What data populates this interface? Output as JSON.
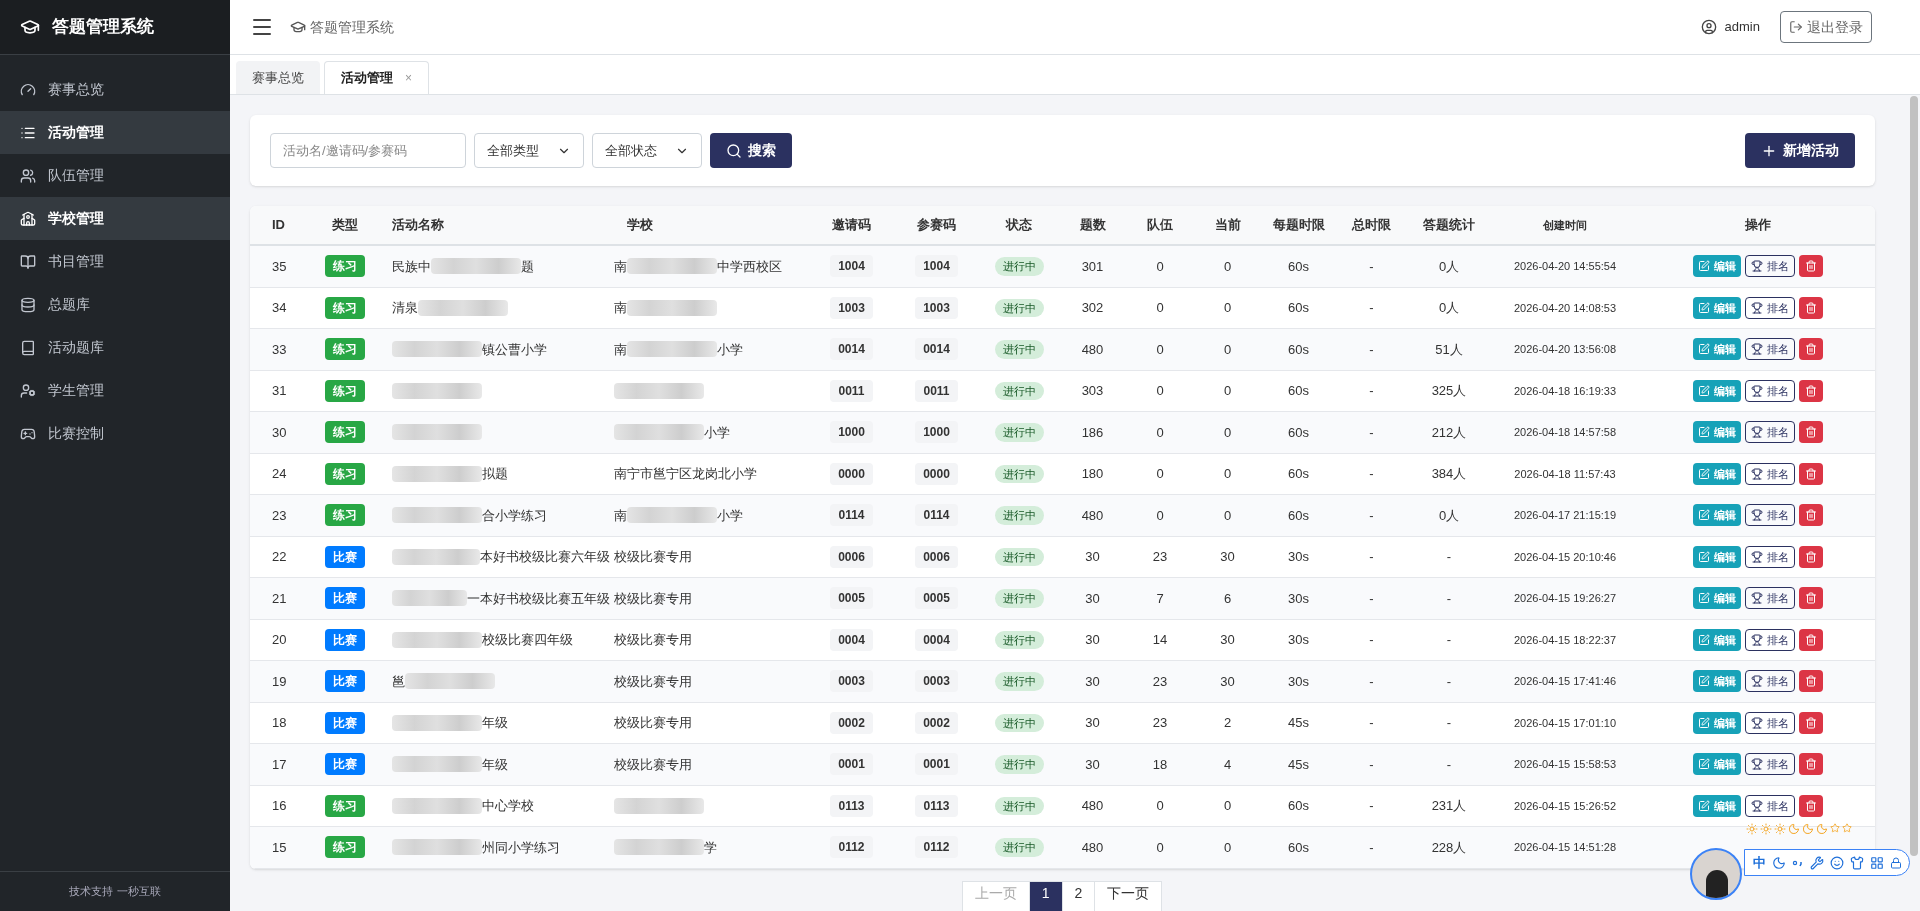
{
  "brand": "答题管理系统",
  "sidebar": {
    "items": [
      {
        "label": "赛事总览",
        "selected": false
      },
      {
        "label": "活动管理",
        "selected": true
      },
      {
        "label": "队伍管理",
        "selected": false
      },
      {
        "label": "学校管理",
        "selected": true
      },
      {
        "label": "书目管理",
        "selected": false
      },
      {
        "label": "总题库",
        "selected": false
      },
      {
        "label": "活动题库",
        "selected": false
      },
      {
        "label": "学生管理",
        "selected": false
      },
      {
        "label": "比赛控制",
        "selected": false
      }
    ],
    "footer": "技术支持 一秒互联"
  },
  "header": {
    "breadcrumb": "答题管理系统",
    "user": "admin",
    "logout": "退出登录"
  },
  "tabs": [
    {
      "label": "赛事总览",
      "selected": false,
      "closable": false
    },
    {
      "label": "活动管理",
      "selected": true,
      "closable": true,
      "close": "×"
    }
  ],
  "filters": {
    "search": {
      "placeholder": "活动名/邀请码/参赛码"
    },
    "type_select": "全部类型",
    "status_select": "全部状态",
    "search_button": "搜索",
    "add_button": "新增活动"
  },
  "table": {
    "columns": [
      "ID",
      "类型",
      "活动名称",
      "学校",
      "邀请码",
      "参赛码",
      "状态",
      "题数",
      "队伍",
      "当前",
      "每题时限",
      "总时限",
      "答题统计",
      "创建时间",
      "操作"
    ],
    "rows": [
      {
        "id": "35",
        "type": {
          "kind": "practice",
          "label": "练习"
        },
        "name": [
          {
            "kind": "text",
            "text": "民族中"
          },
          {
            "kind": "blur"
          },
          {
            "kind": "text",
            "text": "题"
          }
        ],
        "school": [
          {
            "kind": "text",
            "text": "南"
          },
          {
            "kind": "blur"
          },
          {
            "kind": "text",
            "text": "中学西校区"
          }
        ],
        "invite": "1004",
        "code": "1004",
        "status": "进行中",
        "questions": "301",
        "teams": "0",
        "current": "0",
        "per_limit": "60s",
        "total_limit": "-",
        "stats": "0人",
        "created": "2026-04-20 14:55:54",
        "edit": "编辑",
        "rank": "排名",
        "actions_visible": true
      },
      {
        "id": "34",
        "type": {
          "kind": "practice",
          "label": "练习"
        },
        "name": [
          {
            "kind": "text",
            "text": "清泉"
          },
          {
            "kind": "blur"
          }
        ],
        "school": [
          {
            "kind": "text",
            "text": "南"
          },
          {
            "kind": "blur"
          }
        ],
        "invite": "1003",
        "code": "1003",
        "status": "进行中",
        "questions": "302",
        "teams": "0",
        "current": "0",
        "per_limit": "60s",
        "total_limit": "-",
        "stats": "0人",
        "created": "2026-04-20 14:08:53",
        "edit": "编辑",
        "rank": "排名",
        "actions_visible": true
      },
      {
        "id": "33",
        "type": {
          "kind": "practice",
          "label": "练习"
        },
        "name": [
          {
            "kind": "blur"
          },
          {
            "kind": "text",
            "text": "镇公曹小学"
          }
        ],
        "school": [
          {
            "kind": "text",
            "text": "南"
          },
          {
            "kind": "blur"
          },
          {
            "kind": "text",
            "text": "小学"
          }
        ],
        "invite": "0014",
        "code": "0014",
        "status": "进行中",
        "questions": "480",
        "teams": "0",
        "current": "0",
        "per_limit": "60s",
        "total_limit": "-",
        "stats": "51人",
        "created": "2026-04-20 13:56:08",
        "edit": "编辑",
        "rank": "排名",
        "actions_visible": true
      },
      {
        "id": "31",
        "type": {
          "kind": "practice",
          "label": "练习"
        },
        "name": [
          {
            "kind": "blur"
          }
        ],
        "school": [
          {
            "kind": "blur"
          }
        ],
        "invite": "0011",
        "code": "0011",
        "status": "进行中",
        "questions": "303",
        "teams": "0",
        "current": "0",
        "per_limit": "60s",
        "total_limit": "-",
        "stats": "325人",
        "created": "2026-04-18 16:19:33",
        "edit": "编辑",
        "rank": "排名",
        "actions_visible": true
      },
      {
        "id": "30",
        "type": {
          "kind": "practice",
          "label": "练习"
        },
        "name": [
          {
            "kind": "blur"
          }
        ],
        "school": [
          {
            "kind": "blur"
          },
          {
            "kind": "text",
            "text": "小学"
          }
        ],
        "invite": "1000",
        "code": "1000",
        "status": "进行中",
        "questions": "186",
        "teams": "0",
        "current": "0",
        "per_limit": "60s",
        "total_limit": "-",
        "stats": "212人",
        "created": "2026-04-18 14:57:58",
        "edit": "编辑",
        "rank": "排名",
        "actions_visible": true
      },
      {
        "id": "24",
        "type": {
          "kind": "practice",
          "label": "练习"
        },
        "name": [
          {
            "kind": "blur"
          },
          {
            "kind": "text",
            "text": "拟题"
          }
        ],
        "school": [
          {
            "kind": "text",
            "text": "南宁市邕宁区龙岗北小学"
          }
        ],
        "invite": "0000",
        "code": "0000",
        "status": "进行中",
        "questions": "180",
        "teams": "0",
        "current": "0",
        "per_limit": "60s",
        "total_limit": "-",
        "stats": "384人",
        "created": "2026-04-18 11:57:43",
        "edit": "编辑",
        "rank": "排名",
        "actions_visible": true
      },
      {
        "id": "23",
        "type": {
          "kind": "practice",
          "label": "练习"
        },
        "name": [
          {
            "kind": "blur"
          },
          {
            "kind": "text",
            "text": "合小学练习"
          }
        ],
        "school": [
          {
            "kind": "text",
            "text": "南"
          },
          {
            "kind": "blur"
          },
          {
            "kind": "text",
            "text": "小学"
          }
        ],
        "invite": "0114",
        "code": "0114",
        "status": "进行中",
        "questions": "480",
        "teams": "0",
        "current": "0",
        "per_limit": "60s",
        "total_limit": "-",
        "stats": "0人",
        "created": "2026-04-17 21:15:19",
        "edit": "编辑",
        "rank": "排名",
        "actions_visible": true
      },
      {
        "id": "22",
        "type": {
          "kind": "contest",
          "label": "比赛"
        },
        "name": [
          {
            "kind": "blur"
          },
          {
            "kind": "text",
            "text": "本好书校级比赛六年级"
          }
        ],
        "school": [
          {
            "kind": "text",
            "text": "校级比赛专用"
          }
        ],
        "invite": "0006",
        "code": "0006",
        "status": "进行中",
        "questions": "30",
        "teams": "23",
        "current": "30",
        "per_limit": "30s",
        "total_limit": "-",
        "stats": "-",
        "created": "2026-04-15 20:10:46",
        "edit": "编辑",
        "rank": "排名",
        "actions_visible": true
      },
      {
        "id": "21",
        "type": {
          "kind": "contest",
          "label": "比赛"
        },
        "name": [
          {
            "kind": "blur"
          },
          {
            "kind": "text",
            "text": "一本好书校级比赛五年级"
          }
        ],
        "school": [
          {
            "kind": "text",
            "text": "校级比赛专用"
          }
        ],
        "invite": "0005",
        "code": "0005",
        "status": "进行中",
        "questions": "30",
        "teams": "7",
        "current": "6",
        "per_limit": "30s",
        "total_limit": "-",
        "stats": "-",
        "created": "2026-04-15 19:26:27",
        "edit": "编辑",
        "rank": "排名",
        "actions_visible": true
      },
      {
        "id": "20",
        "type": {
          "kind": "contest",
          "label": "比赛"
        },
        "name": [
          {
            "kind": "blur"
          },
          {
            "kind": "text",
            "text": "校级比赛四年级"
          }
        ],
        "school": [
          {
            "kind": "text",
            "text": "校级比赛专用"
          }
        ],
        "invite": "0004",
        "code": "0004",
        "status": "进行中",
        "questions": "30",
        "teams": "14",
        "current": "30",
        "per_limit": "30s",
        "total_limit": "-",
        "stats": "-",
        "created": "2026-04-15 18:22:37",
        "edit": "编辑",
        "rank": "排名",
        "actions_visible": true
      },
      {
        "id": "19",
        "type": {
          "kind": "contest",
          "label": "比赛"
        },
        "name": [
          {
            "kind": "text",
            "text": "邕"
          },
          {
            "kind": "blur"
          }
        ],
        "school": [
          {
            "kind": "text",
            "text": "校级比赛专用"
          }
        ],
        "invite": "0003",
        "code": "0003",
        "status": "进行中",
        "questions": "30",
        "teams": "23",
        "current": "30",
        "per_limit": "30s",
        "total_limit": "-",
        "stats": "-",
        "created": "2026-04-15 17:41:46",
        "edit": "编辑",
        "rank": "排名",
        "actions_visible": true
      },
      {
        "id": "18",
        "type": {
          "kind": "contest",
          "label": "比赛"
        },
        "name": [
          {
            "kind": "blur"
          },
          {
            "kind": "text",
            "text": "年级"
          }
        ],
        "school": [
          {
            "kind": "text",
            "text": "校级比赛专用"
          }
        ],
        "invite": "0002",
        "code": "0002",
        "status": "进行中",
        "questions": "30",
        "teams": "23",
        "current": "2",
        "per_limit": "45s",
        "total_limit": "-",
        "stats": "-",
        "created": "2026-04-15 17:01:10",
        "edit": "编辑",
        "rank": "排名",
        "actions_visible": true
      },
      {
        "id": "17",
        "type": {
          "kind": "contest",
          "label": "比赛"
        },
        "name": [
          {
            "kind": "blur"
          },
          {
            "kind": "text",
            "text": "年级"
          }
        ],
        "school": [
          {
            "kind": "text",
            "text": "校级比赛专用"
          }
        ],
        "invite": "0001",
        "code": "0001",
        "status": "进行中",
        "questions": "30",
        "teams": "18",
        "current": "4",
        "per_limit": "45s",
        "total_limit": "-",
        "stats": "-",
        "created": "2026-04-15 15:58:53",
        "edit": "编辑",
        "rank": "排名",
        "actions_visible": true
      },
      {
        "id": "16",
        "type": {
          "kind": "practice",
          "label": "练习"
        },
        "name": [
          {
            "kind": "blur"
          },
          {
            "kind": "text",
            "text": "中心学校"
          }
        ],
        "school": [
          {
            "kind": "blur"
          }
        ],
        "invite": "0113",
        "code": "0113",
        "status": "进行中",
        "questions": "480",
        "teams": "0",
        "current": "0",
        "per_limit": "60s",
        "total_limit": "-",
        "stats": "231人",
        "created": "2026-04-15 15:26:52",
        "edit": "编辑",
        "rank": "排名",
        "actions_visible": true
      },
      {
        "id": "15",
        "type": {
          "kind": "practice",
          "label": "练习"
        },
        "name": [
          {
            "kind": "blur"
          },
          {
            "kind": "text",
            "text": "州同小学练习"
          }
        ],
        "school": [
          {
            "kind": "blur"
          },
          {
            "kind": "text",
            "text": "学"
          }
        ],
        "invite": "0112",
        "code": "0112",
        "status": "进行中",
        "questions": "480",
        "teams": "0",
        "current": "0",
        "per_limit": "60s",
        "total_limit": "-",
        "stats": "228人",
        "created": "2026-04-15 14:51:28",
        "actions_visible": false
      }
    ]
  },
  "pagination": [
    {
      "label": "上一页",
      "selected": false,
      "disabled": true
    },
    {
      "label": "1",
      "selected": true,
      "disabled": false
    },
    {
      "label": "2",
      "selected": false,
      "disabled": false
    },
    {
      "label": "下一页",
      "selected": false,
      "disabled": false
    }
  ],
  "ime_toolbar": {
    "mode": "中"
  }
}
